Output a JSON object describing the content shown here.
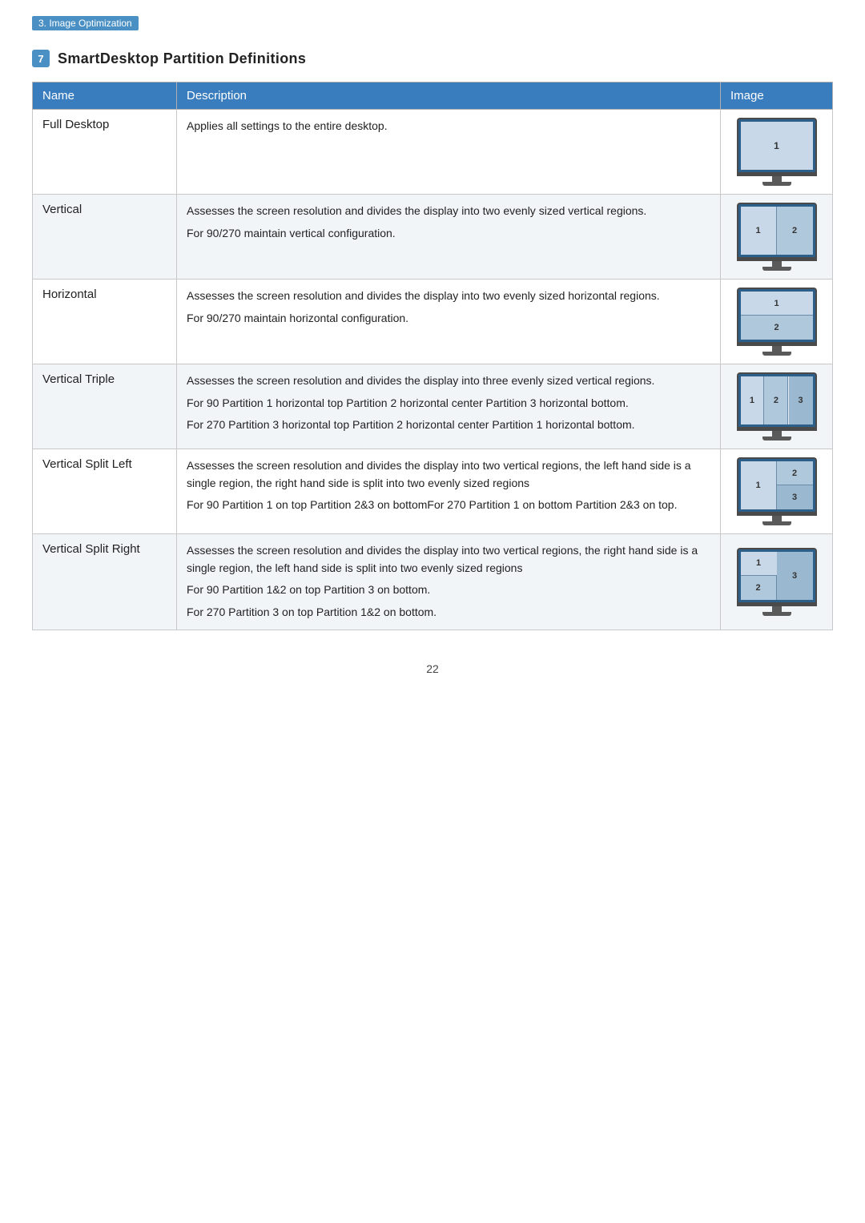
{
  "breadcrumb": "3. Image Optimization",
  "section": {
    "number": "7",
    "title": "SmartDesktop Partition Definitions"
  },
  "table": {
    "headers": [
      "Name",
      "Description",
      "Image"
    ],
    "rows": [
      {
        "name": "Full Desktop",
        "description": [
          "Applies all settings to the entire desktop."
        ],
        "partition_type": "full"
      },
      {
        "name": "Vertical",
        "description": [
          "Assesses the screen resolution and divides the display into two evenly sized vertical regions.",
          "For 90/270 maintain vertical configuration."
        ],
        "partition_type": "vertical"
      },
      {
        "name": "Horizontal",
        "description": [
          "Assesses the screen resolution and divides the display into two evenly sized horizontal regions.",
          "For 90/270 maintain horizontal configuration."
        ],
        "partition_type": "horizontal"
      },
      {
        "name": "Vertical Triple",
        "description": [
          "Assesses the screen resolution and divides the display into three evenly sized vertical regions.",
          "For 90 Partition 1 horizontal top Partition 2 horizontal center Partition 3 horizontal bottom.",
          "For 270 Partition 3 horizontal top Partition 2 horizontal center Partition 1 horizontal bottom."
        ],
        "partition_type": "vertical-triple"
      },
      {
        "name": "Vertical Split Left",
        "description": [
          "Assesses the screen resolution and divides the display into two vertical regions, the left hand side is a single region, the right hand side is split into two evenly sized regions",
          "For 90 Partition 1 on top Partition 2&3 on bottomFor 270 Partition 1 on bottom Partition 2&3 on top."
        ],
        "partition_type": "vertical-split-left"
      },
      {
        "name": "Vertical Split Right",
        "description": [
          "Assesses the screen resolution and divides the display into two vertical regions, the right hand side is a single region, the left hand side is split into two evenly sized regions",
          "For 90 Partition 1&2 on top Partition 3 on bottom.",
          "For 270 Partition 3 on top Partition 1&2 on bottom."
        ],
        "partition_type": "vertical-split-right"
      }
    ]
  },
  "page_number": "22"
}
